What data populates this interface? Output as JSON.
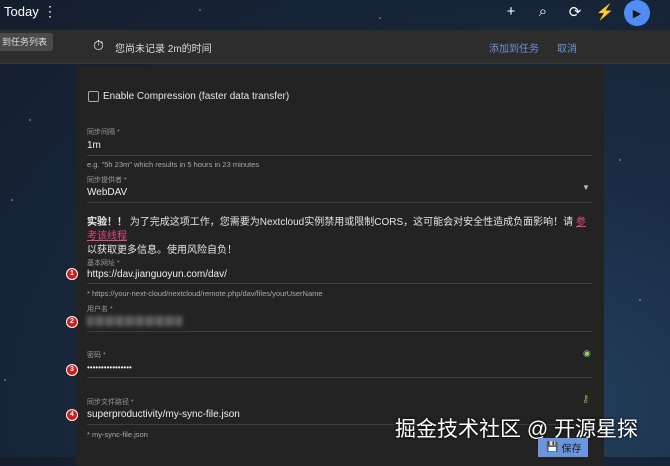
{
  "header": {
    "title": "Today",
    "icons": [
      "more-vert-icon",
      "add-icon",
      "search-icon",
      "sync-icon",
      "flash-icon",
      "play-icon"
    ]
  },
  "banner": {
    "move_button": "到任务列表",
    "message": "您尚未记录 2m的时间",
    "add_to_task": "添加到任务",
    "cancel": "取消"
  },
  "form": {
    "compression_label": "Enable Compression (faster data transfer)",
    "compression_checked": false,
    "sync_interval": {
      "label": "同步间隔 *",
      "value": "1m",
      "hint": "e.g. \"5h 23m\" which results in 5 hours in 23 minutes"
    },
    "sync_provider": {
      "label": "同步提供者 *",
      "value": "WebDAV"
    },
    "warning": {
      "bold": "实验！！",
      "text": " 为了完成这项工作，您需要为Nextcloud实例禁用或限制CORS，这可能会对安全性造成负面影响！请 ",
      "link": "参考该线程",
      "text2": "以获取更多信息。使用风险自负！"
    },
    "base_url": {
      "badge": "1",
      "label": "基本网址 *",
      "value": "https://dav.jianguoyun.com/dav/",
      "hint": "* https://your-next-cloud/nextcloud/remote.php/dav/files/yourUserName"
    },
    "username": {
      "badge": "2",
      "label": "用户名 *"
    },
    "password": {
      "badge": "3",
      "label": "密码 *",
      "value": "••••••••••••••••"
    },
    "sync_file_path": {
      "badge": "4",
      "label": "同步文件路径 *",
      "value": "superproductivity/my-sync-file.json",
      "hint": "* my-sync-file.json"
    },
    "save": "保存"
  },
  "watermark": "掘金技术社区 @ 开源星探",
  "colors": {
    "accent": "#4f8df5",
    "badge": "#d01c1c",
    "link": "#e04a8a"
  }
}
